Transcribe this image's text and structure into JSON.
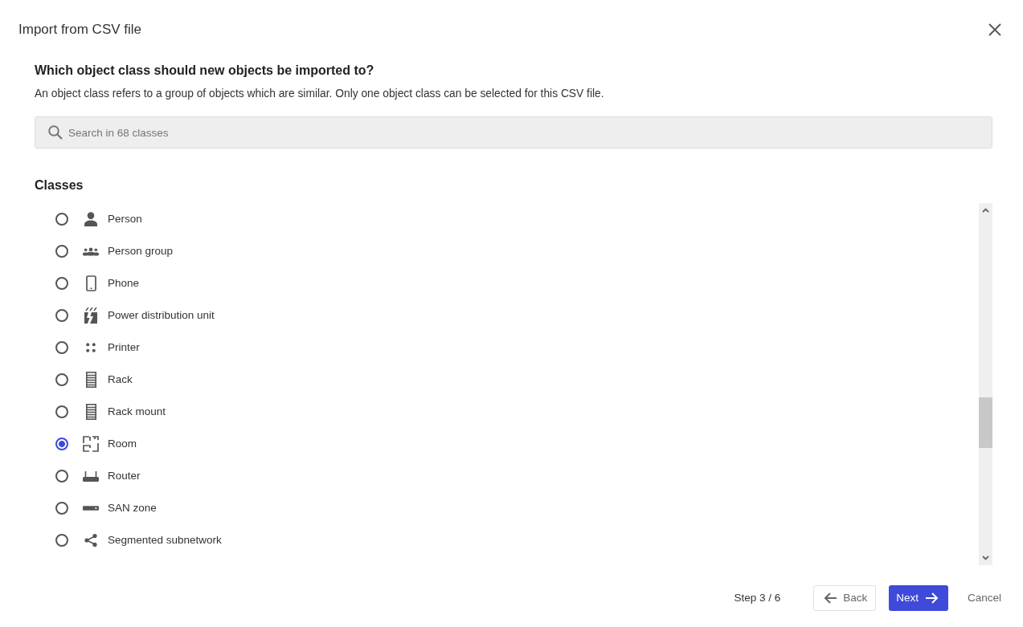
{
  "dialog": {
    "title": "Import from CSV file"
  },
  "question": "Which object class should new objects be imported to?",
  "description": "An object class refers to a group of objects which are similar. Only one object class can be selected for this CSV file.",
  "search": {
    "placeholder": "Search in 68 classes"
  },
  "classes": {
    "heading": "Classes",
    "items": [
      {
        "label": "Person",
        "selected": false
      },
      {
        "label": "Person group",
        "selected": false
      },
      {
        "label": "Phone",
        "selected": false
      },
      {
        "label": "Power distribution unit",
        "selected": false
      },
      {
        "label": "Printer",
        "selected": false
      },
      {
        "label": "Rack",
        "selected": false
      },
      {
        "label": "Rack mount",
        "selected": false
      },
      {
        "label": "Room",
        "selected": true
      },
      {
        "label": "Router",
        "selected": false
      },
      {
        "label": "SAN zone",
        "selected": false
      },
      {
        "label": "Segmented subnetwork",
        "selected": false
      }
    ]
  },
  "footer": {
    "step": "Step 3 / 6",
    "buttons": [
      {
        "kind": "back",
        "label": "Back"
      },
      {
        "kind": "next",
        "label": "Next"
      },
      {
        "kind": "cancel",
        "label": "Cancel"
      }
    ]
  }
}
